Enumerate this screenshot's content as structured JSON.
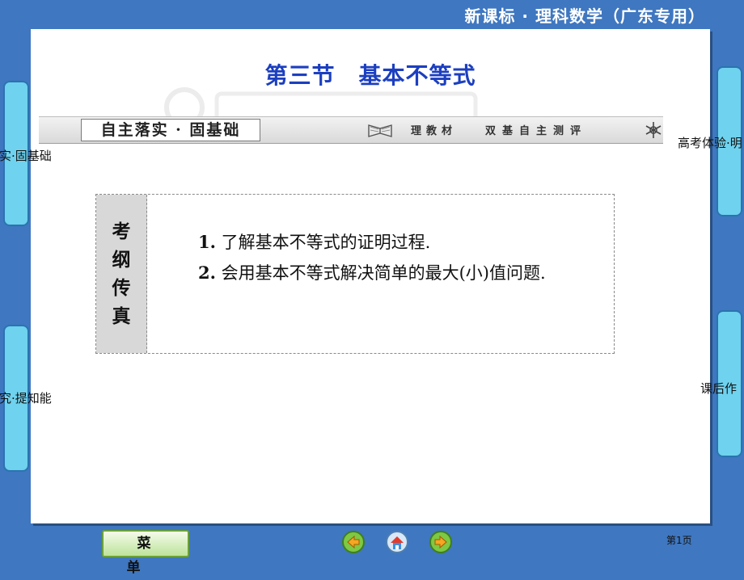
{
  "header": {
    "title": "新课标 · 理科数学（广东专用）"
  },
  "slide": {
    "title": "第三节　基本不等式",
    "section": {
      "label": "自主落实 · 固基础",
      "sub_a": "理教材",
      "sub_b": "双基自主测评"
    },
    "box": {
      "side_chars": [
        "考",
        "纲",
        "传",
        "真"
      ],
      "items": [
        {
          "num": "1.",
          "text": " 了解基本不等式的证明过程."
        },
        {
          "num": "2.",
          "text": " 会用基本不等式解决简单的最大(小)值问题."
        }
      ]
    }
  },
  "side_tabs": {
    "left_top": "落实·固基础",
    "left_bottom": "探究·提知能",
    "right_top": "高考体验·明",
    "right_bottom": "课后作"
  },
  "footer": {
    "menu_label": "菜单",
    "page_label": "第1页"
  },
  "colors": {
    "background": "#3f77c0",
    "title": "#1c3fc0",
    "tab": "#6fd2ee"
  }
}
